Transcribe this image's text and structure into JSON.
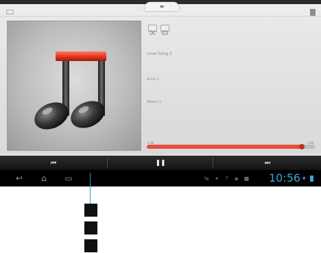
{
  "track": {
    "title": "Love Song 2",
    "artist": "Artist 1",
    "album": "Album 1",
    "time_current": "0:48",
    "time_total": "3:46",
    "progress_fraction": 0.92
  },
  "player_bar": {
    "prev_symbol": "⏮",
    "pause_symbol": "❚❚",
    "next_symbol": "⏭"
  },
  "nav": {
    "back_symbol": "↩",
    "home_symbol": "⌂",
    "recents_symbol": "▭"
  },
  "status": {
    "icons": [
      "↹",
      "✦",
      "⇡",
      "▪",
      "■"
    ],
    "clock": "10:56"
  },
  "colors": {
    "accent": "#e24f3d",
    "clock": "#3aa6d8",
    "callout": "#2d9ad3"
  },
  "icons": {
    "album_art": "music-note-icon",
    "shuffle": "shuffle-icon",
    "repeat": "repeat-icon"
  }
}
